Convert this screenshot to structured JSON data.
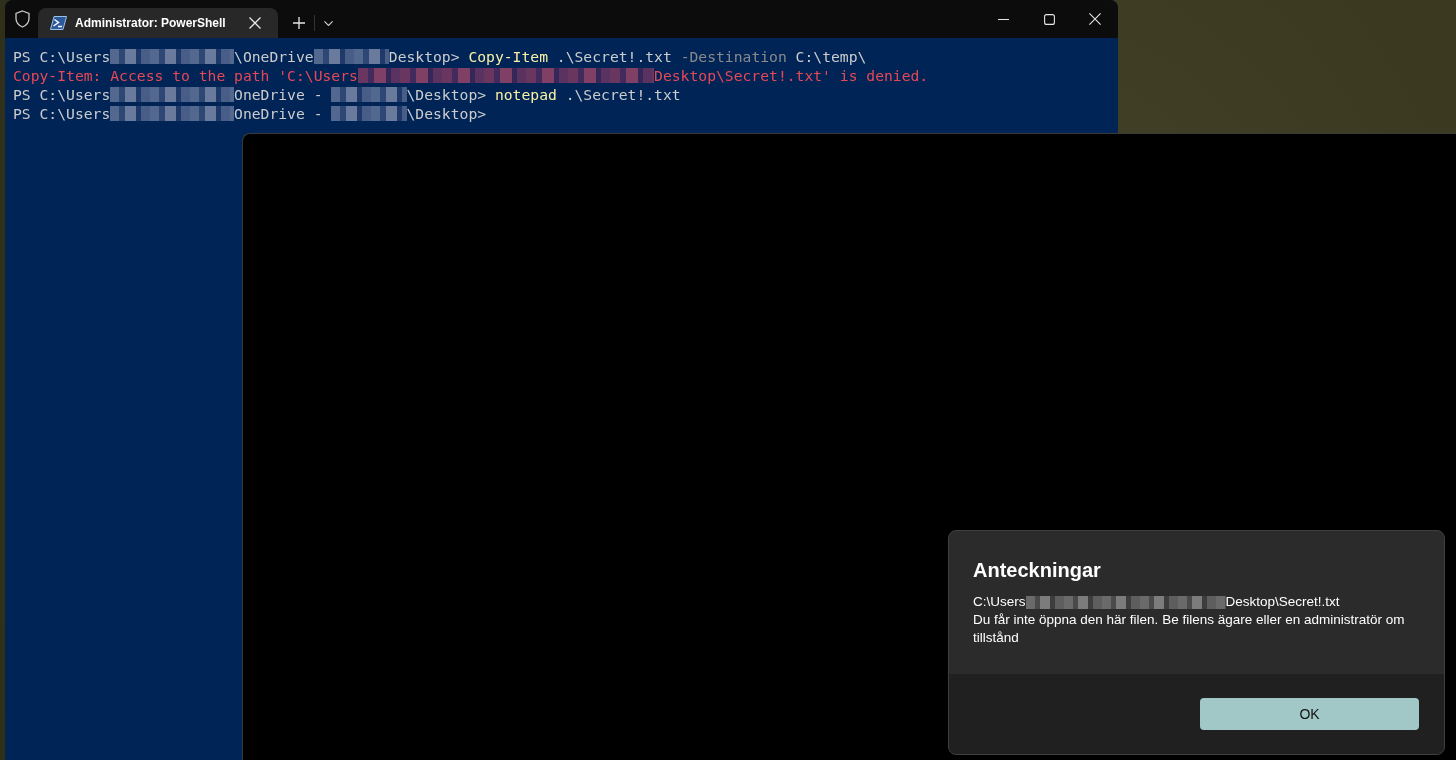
{
  "terminal": {
    "tabs": [
      {
        "title": "Administrator: PowerShell",
        "selected": true
      }
    ],
    "lines": [
      {
        "kind": "prompt",
        "segments": [
          {
            "kind": "text",
            "text": "PS C:\\Users"
          },
          {
            "kind": "redacted"
          },
          {
            "kind": "text",
            "text": "\\OneDrive"
          },
          {
            "kind": "redacted"
          },
          {
            "kind": "text",
            "text": "Desktop> "
          },
          {
            "kind": "command",
            "text": "Copy-Item"
          },
          {
            "kind": "text",
            "text": " .\\Secret!.txt "
          },
          {
            "kind": "parameter",
            "text": "-Destination"
          },
          {
            "kind": "text",
            "text": " C:\\temp\\"
          }
        ]
      },
      {
        "kind": "error",
        "segments": [
          {
            "kind": "text",
            "text": "Copy-Item: Access to the path 'C:\\Users"
          },
          {
            "kind": "redacted"
          },
          {
            "kind": "text",
            "text": "Desktop\\Secret!.txt' is denied."
          }
        ]
      },
      {
        "kind": "prompt",
        "segments": [
          {
            "kind": "text",
            "text": "PS C:\\Users"
          },
          {
            "kind": "redacted"
          },
          {
            "kind": "text",
            "text": "OneDrive - "
          },
          {
            "kind": "redacted"
          },
          {
            "kind": "text",
            "text": "\\Desktop> "
          },
          {
            "kind": "command",
            "text": "notepad"
          },
          {
            "kind": "text",
            "text": " .\\Secret!.txt"
          }
        ]
      },
      {
        "kind": "prompt",
        "segments": [
          {
            "kind": "text",
            "text": "PS C:\\Users"
          },
          {
            "kind": "redacted"
          },
          {
            "kind": "text",
            "text": "OneDrive - "
          },
          {
            "kind": "redacted"
          },
          {
            "kind": "text",
            "text": "\\Desktop>"
          }
        ]
      }
    ]
  },
  "dialog": {
    "title": "Anteckningar",
    "path": [
      {
        "kind": "text",
        "text": "C:\\Users"
      },
      {
        "kind": "redacted"
      },
      {
        "kind": "text",
        "text": "Desktop\\Secret!.txt"
      }
    ],
    "message": "Du får inte öppna den här filen. Be filens ägare eller en administratör om tillstånd",
    "buttons": [
      "OK"
    ]
  }
}
